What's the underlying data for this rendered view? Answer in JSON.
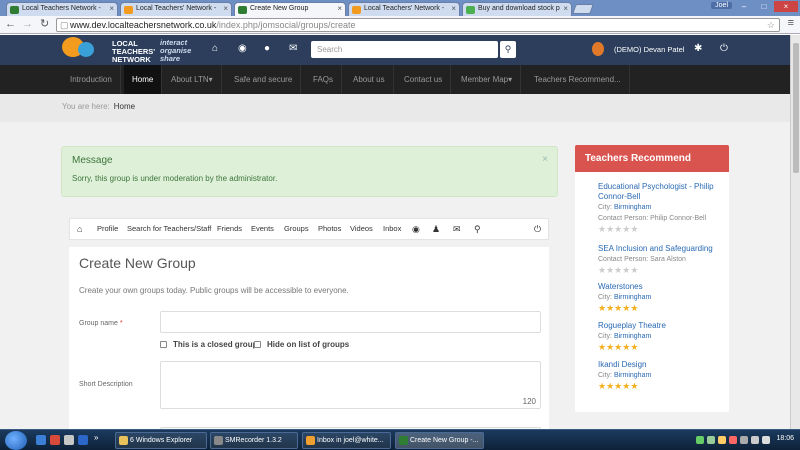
{
  "browser": {
    "tabs": [
      {
        "title": "Local Teachers Network -",
        "color": "#2e7d32",
        "active": false
      },
      {
        "title": "Local Teachers' Network -",
        "color": "#f39b1f",
        "active": false
      },
      {
        "title": "Create New Group",
        "color": "#2e7d32",
        "active": true
      },
      {
        "title": "Local Teachers' Network -",
        "color": "#f39b1f",
        "active": false
      },
      {
        "title": "Buy and download stock p",
        "color": "#4caf50",
        "active": false
      }
    ],
    "user": "Joel",
    "url_host": "www.dev.localteachersnetwork.co.uk",
    "url_path": "/index.php/jomsocial/groups/create"
  },
  "site": {
    "logo_line1": "LOCAL",
    "logo_line2": "TEACHERS'",
    "logo_line3": "NETWORK",
    "tag1": "interact",
    "tag2": "organise",
    "tag3": "share",
    "search_placeholder": "Search",
    "user_name": "(DEMO) Devan Patel"
  },
  "nav": [
    "Introduction",
    "Home",
    "About LTN▾",
    "Safe and secure",
    "FAQs",
    "About us",
    "Contact us",
    "Member Map▾",
    "Teachers Recommend..."
  ],
  "breadcrumb": {
    "label": "You are here:",
    "current": "Home"
  },
  "alert": {
    "title": "Message",
    "text": "Sorry, this group is under moderation by the administrator.",
    "close": "×"
  },
  "community_toolbar": [
    "Profile",
    "Search for Teachers/Staff",
    "Friends",
    "Events",
    "Groups",
    "Photos",
    "Videos",
    "Inbox"
  ],
  "form": {
    "title": "Create New Group",
    "description": "Create your own groups today. Public groups will be accessible to everyone.",
    "group_name_label": "Group name",
    "required_mark": "*",
    "closed_group_label": "This is a closed group",
    "hide_label": "Hide on list of groups",
    "short_desc_label": "Short Description",
    "char_count": "120"
  },
  "sidebar": {
    "title": "Teachers Recommend",
    "items": [
      {
        "name": "Educational Psychologist - Philip Connor-Bell",
        "city_label": "City:",
        "city": "Birmingham",
        "contact": "Contact Person: Philip Connor-Bell",
        "rating": 0
      },
      {
        "name": "SEA Inclusion and Safeguarding",
        "city_label": "",
        "city": "",
        "contact": "Contact Person: Sara Alston",
        "rating": 0
      },
      {
        "name": "Waterstones",
        "city_label": "City:",
        "city": "Birmingham",
        "contact": "",
        "rating": 5
      },
      {
        "name": "Rogueplay Theatre",
        "city_label": "City:",
        "city": "Birmingham",
        "contact": "",
        "rating": 5
      },
      {
        "name": "Ikandi Design",
        "city_label": "City:",
        "city": "Birmingham",
        "contact": "",
        "rating": 5
      }
    ]
  },
  "taskbar": {
    "tasks": [
      {
        "label": "6 Windows Explorer",
        "color": "#e8c25a"
      },
      {
        "label": "SMRecorder 1.3.2",
        "color": "#888"
      },
      {
        "label": "Inbox in joel@white...",
        "color": "#f0a030"
      },
      {
        "label": "Create New Group -...",
        "color": "#2e7d32"
      }
    ],
    "time": "18:06"
  }
}
